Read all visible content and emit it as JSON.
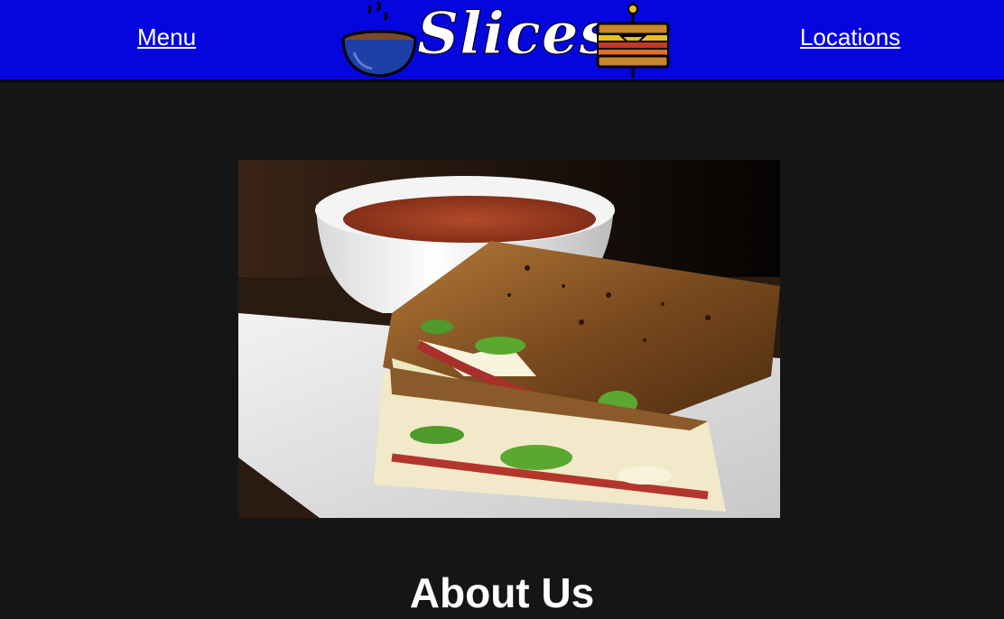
{
  "nav": {
    "menu_label": "Menu",
    "locations_label": "Locations",
    "logo_text": "Slices",
    "brand_color": "#0505dd"
  },
  "hero": {
    "image_subject": "grilled-sandwich-with-tomato-soup"
  },
  "about": {
    "heading": "About Us"
  }
}
